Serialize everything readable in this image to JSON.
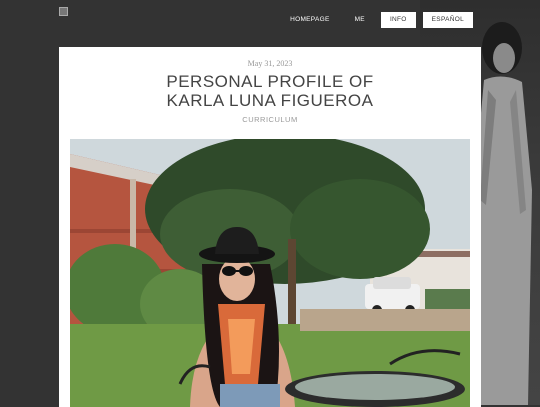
{
  "site": {
    "logo_alt": ""
  },
  "nav": {
    "items": [
      {
        "label": "HOMEPAGE",
        "style": "plain"
      },
      {
        "label": "ME",
        "style": "plain"
      },
      {
        "label": "INFO",
        "style": "boxed"
      },
      {
        "label": "ESPAÑOL",
        "style": "boxed"
      }
    ]
  },
  "post": {
    "date": "May 31, 2023",
    "title_line1": "PERSONAL PROFILE OF",
    "title_line2": "KARLA LUNA FIGUEROA",
    "category": "CURRICULUM",
    "image_alt": "Woman in black hat and sunglasses seated outdoors in a garden"
  },
  "colors": {
    "page_bg": "#333333",
    "card_bg": "#ffffff",
    "title_text": "#444444",
    "meta_text": "#999999"
  }
}
